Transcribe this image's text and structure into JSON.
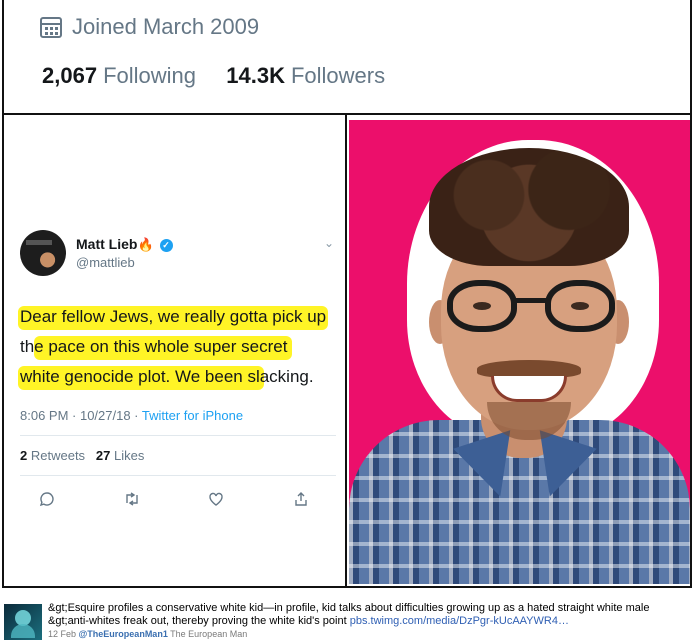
{
  "profile": {
    "joined_label": "Joined March 2009",
    "following_count": "2,067",
    "following_label": "Following",
    "followers_count": "14.3K",
    "followers_label": "Followers"
  },
  "tweet": {
    "display_name": "Matt Lieb",
    "name_emoji": "🔥",
    "handle": "@mattlieb",
    "body_lines": [
      "Dear fellow Jews, we really gotta pick up",
      "the pace on this whole super secret",
      "white genocide plot. We been slacking."
    ],
    "timestamp": "8:06 PM · 10/27/18 · ",
    "source": "Twitter for iPhone",
    "retweets_count": "2",
    "retweets_label": "Retweets",
    "likes_count": "27",
    "likes_label": "Likes",
    "highlight_color": "#fff200",
    "accent_color": "#1da1f2",
    "icons": [
      "chevron-down-icon",
      "verified-badge-icon",
      "reply-icon",
      "retweet-icon",
      "like-icon",
      "share-icon"
    ]
  },
  "photo": {
    "background_color": "#ec0f6b"
  },
  "post": {
    "text": "&gt;Esquire profiles a conservative white kid—in profile, kid talks about difficulties growing up as a hated straight white male &gt;anti-whites freak out, thereby proving the white kid's point ",
    "link": "pbs.twimg.com/media/DzPgr-kUcAAYWR4…",
    "date": "12 Feb ",
    "author_handle": "@TheEuropeanMan1",
    "author_name": " The European Man"
  }
}
